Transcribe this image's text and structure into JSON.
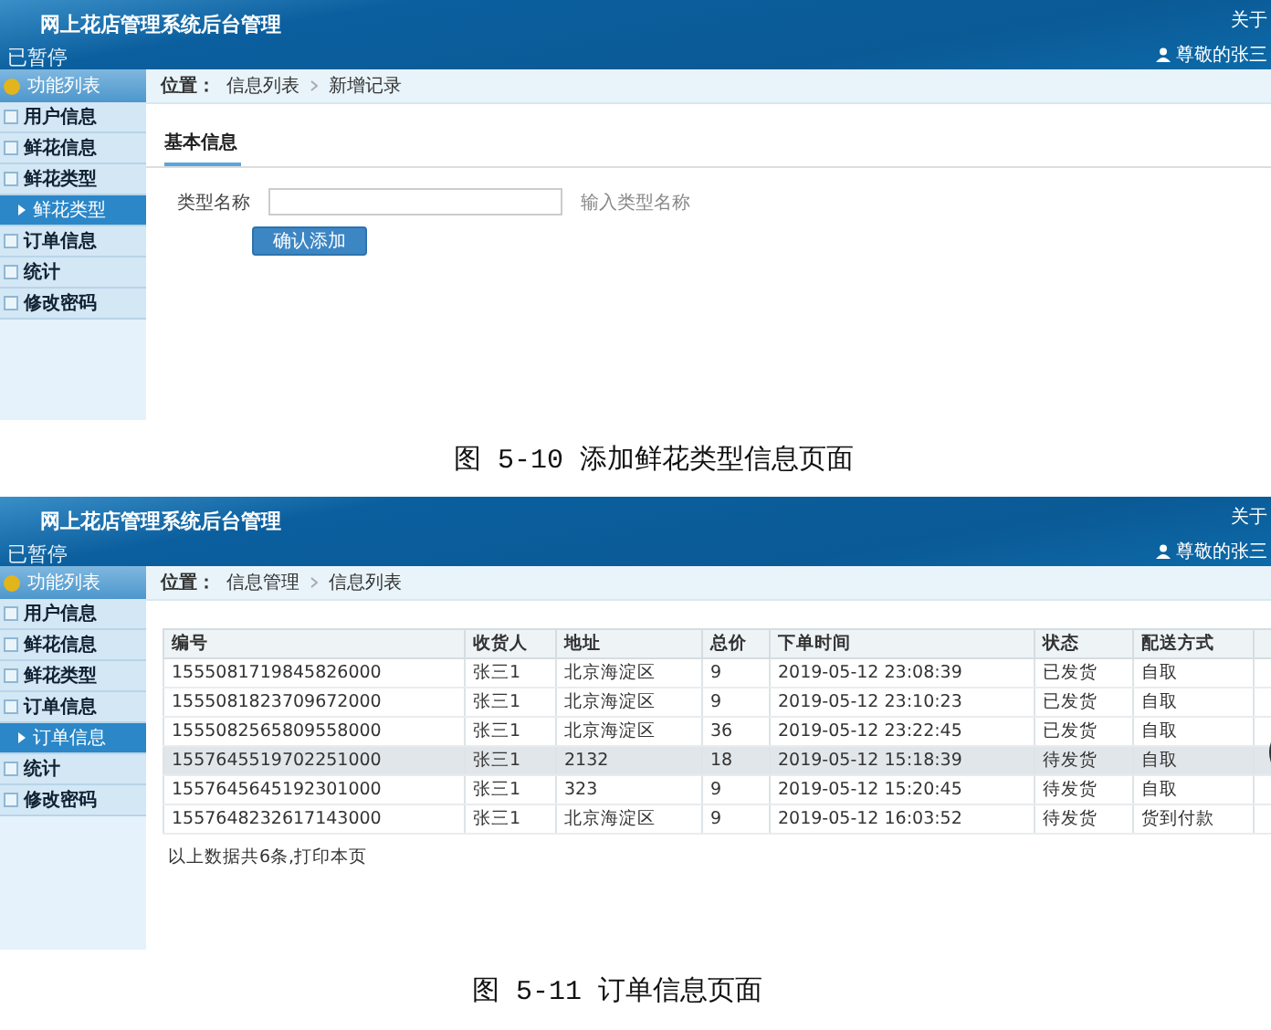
{
  "figures": [
    {
      "kind": "form",
      "header": {
        "title": "网上花店管理系统后台管理",
        "status": "已暂停",
        "about": "关于",
        "user": "尊敬的张三"
      },
      "sidebar": {
        "title": "功能列表",
        "items": [
          {
            "label": "用户信息",
            "selected": false
          },
          {
            "label": "鲜花信息",
            "selected": false
          },
          {
            "label": "鲜花类型",
            "selected": false,
            "children": [
              {
                "label": "鲜花类型",
                "selected": true
              }
            ]
          },
          {
            "label": "订单信息",
            "selected": false
          },
          {
            "label": "统计",
            "selected": false
          },
          {
            "label": "修改密码",
            "selected": false
          }
        ]
      },
      "breadcrumb": {
        "label": "位置：",
        "path": [
          "信息列表",
          "新增记录"
        ]
      },
      "form": {
        "tab": "基本信息",
        "field_label": "类型名称",
        "hint": "输入类型名称",
        "button": "确认添加"
      },
      "caption": "图 5-10 添加鲜花类型信息页面"
    },
    {
      "kind": "table",
      "header": {
        "title": "网上花店管理系统后台管理",
        "status": "已暂停",
        "about": "关于",
        "user": "尊敬的张三"
      },
      "sidebar": {
        "title": "功能列表",
        "items": [
          {
            "label": "用户信息",
            "selected": false
          },
          {
            "label": "鲜花信息",
            "selected": false
          },
          {
            "label": "鲜花类型",
            "selected": false
          },
          {
            "label": "订单信息",
            "selected": false,
            "children": [
              {
                "label": "订单信息",
                "selected": true
              }
            ]
          },
          {
            "label": "统计",
            "selected": false
          },
          {
            "label": "修改密码",
            "selected": false
          }
        ]
      },
      "breadcrumb": {
        "label": "位置：",
        "path": [
          "信息管理",
          "信息列表"
        ]
      },
      "table": {
        "columns": [
          "编号",
          "收货人",
          "地址",
          "总价",
          "下单时间",
          "状态",
          "配送方式"
        ],
        "rows": [
          {
            "selected": false,
            "cells": [
              "1555081719845826000",
              "张三1",
              "北京海淀区",
              "9",
              "2019-05-12 23:08:39",
              "已发货",
              "自取"
            ]
          },
          {
            "selected": false,
            "cells": [
              "1555081823709672000",
              "张三1",
              "北京海淀区",
              "9",
              "2019-05-12 23:10:23",
              "已发货",
              "自取"
            ]
          },
          {
            "selected": false,
            "cells": [
              "1555082565809558000",
              "张三1",
              "北京海淀区",
              "36",
              "2019-05-12 23:22:45",
              "已发货",
              "自取"
            ]
          },
          {
            "selected": true,
            "cells": [
              "1557645519702251000",
              "张三1",
              "2132",
              "18",
              "2019-05-12 15:18:39",
              "待发货",
              "自取"
            ]
          },
          {
            "selected": false,
            "cells": [
              "1557645645192301000",
              "张三1",
              "323",
              "9",
              "2019-05-12 15:20:45",
              "待发货",
              "自取"
            ]
          },
          {
            "selected": false,
            "cells": [
              "1557648232617143000",
              "张三1",
              "北京海淀区",
              "9",
              "2019-05-12 16:03:52",
              "待发货",
              "货到付款"
            ]
          }
        ],
        "footer": "以上数据共6条,打印本页"
      },
      "caption": "图 5-11 订单信息页面"
    }
  ]
}
